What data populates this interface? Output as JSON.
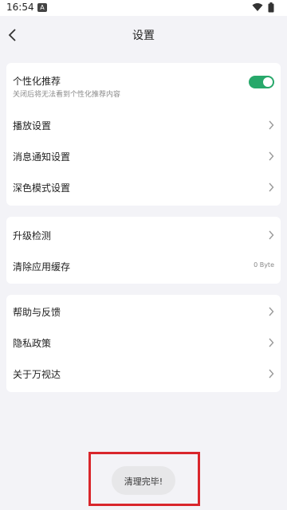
{
  "status_bar": {
    "time": "16:54",
    "badge": "A"
  },
  "header": {
    "title": "设置"
  },
  "card1": {
    "personal": {
      "title": "个性化推荐",
      "subtitle": "关闭后将无法看到个性化推荐内容",
      "enabled": true
    },
    "items": [
      "播放设置",
      "消息通知设置",
      "深色模式设置"
    ]
  },
  "card2": {
    "upgrade": "升级检测",
    "cache": {
      "label": "清除应用缓存",
      "value": "0 Byte"
    }
  },
  "card3": {
    "items": [
      "帮助与反馈",
      "隐私政策",
      "关于万视达"
    ]
  },
  "toast": {
    "text": "清理完毕!"
  },
  "colors": {
    "toggle_on": "#27a86a",
    "highlight": "#d9262c"
  }
}
